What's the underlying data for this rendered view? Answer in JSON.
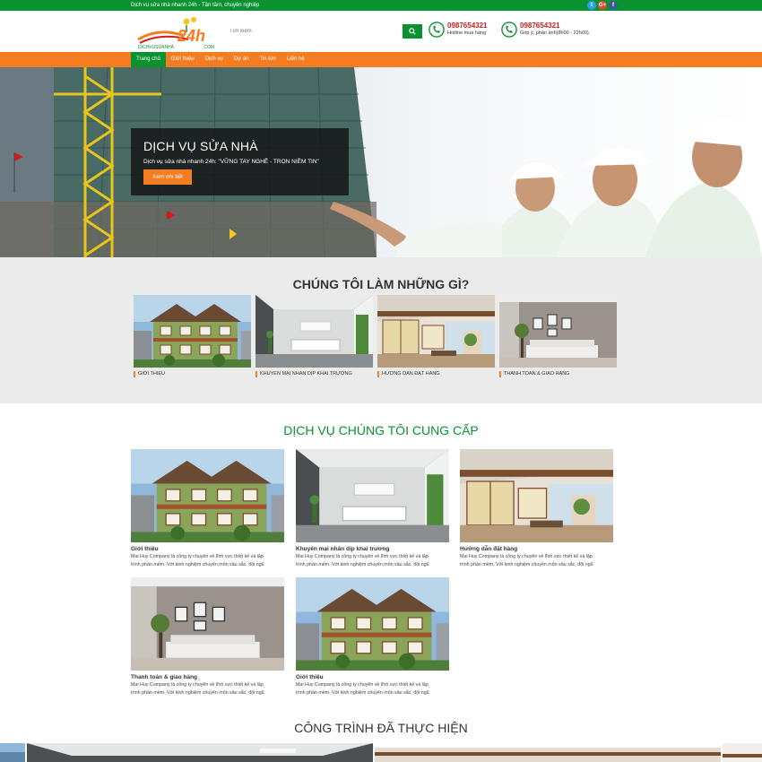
{
  "topbar": {
    "tagline": "Dịch vụ sửa nhà nhanh 24h - Tận tâm, chuyên nghiệp",
    "social": [
      {
        "icon": "twitter-icon",
        "glyph": "t"
      },
      {
        "icon": "google-plus-icon",
        "glyph": "G+"
      },
      {
        "icon": "facebook-icon",
        "glyph": "f"
      }
    ]
  },
  "header": {
    "logo_text": "24h",
    "logo_domain": "DICHVUSUANHA",
    "logo_suffix": ".COM",
    "search_placeholder": "Tìm kiếm",
    "hotlines": [
      {
        "number": "0987654321",
        "label": "Hotline mua hàng"
      },
      {
        "number": "0987654321",
        "label": "Góp ý, phản ánh(8h00 - 22h00)."
      }
    ]
  },
  "nav": {
    "items": [
      "Trang chủ",
      "Giới thiệu",
      "Dịch vụ",
      "Dự án",
      "Tin tức",
      "Liên hệ"
    ],
    "active_index": 0
  },
  "hero": {
    "title": "DỊCH VỤ SỬA NHÀ",
    "subtitle": "Dịch vụ sửa nhà nhanh 24h: \"VỮNG TAY NGHỀ - TRỌN NIỀM TIN\"",
    "button": "Xem chi tiết"
  },
  "what_we_do": {
    "title": "CHÚNG TÔI LÀM NHỮNG GÌ?",
    "cards": [
      {
        "caption": "GIỚI THIỆU"
      },
      {
        "caption": "KHUYẾN MẠI NHÂN DỊP KHAI TRƯƠNG"
      },
      {
        "caption": "HƯỚNG DẪN ĐẶT HÀNG"
      },
      {
        "caption": "THANH TOÁN & GIAO HÀNG"
      }
    ]
  },
  "services": {
    "title": "DỊCH VỤ CHÚNG TÔI CUNG CẤP",
    "items": [
      {
        "title": "Giới thiệu",
        "desc1": "Mai Huy Company là công ty chuyên về lĩnh vực thiết kế và lập",
        "desc2": "trình phần mềm. Với kinh nghiệm chuyên môn sâu sắc, đội ngũ"
      },
      {
        "title": "Khuyến mại nhân dịp khai trương",
        "desc1": "Mai Huy Company là công ty chuyên về lĩnh vực thiết kế và lập",
        "desc2": "trình phần mềm. Với kinh nghiệm chuyên môn sâu sắc, đội ngũ"
      },
      {
        "title": "Hướng dẫn đặt hàng",
        "desc1": "Mai Huy Company là công ty chuyên về lĩnh vực thiết kế và lập",
        "desc2": "trình phần mềm. Với kinh nghiệm chuyên môn sâu sắc, đội ngũ"
      },
      {
        "title": "Thanh toán & giao hàng",
        "desc1": "Mai Huy Company là công ty chuyên về lĩnh vực thiết kế và lập",
        "desc2": "trình phần mềm. Với kinh nghiệm chuyên môn sâu sắc, đội ngũ"
      },
      {
        "title": "Giới thiệu",
        "desc1": "Mai Huy Company là công ty chuyên về lĩnh vực thiết kế và lập",
        "desc2": "trình phần mềm. Với kinh nghiệm chuyên môn sâu sắc, đội ngũ"
      }
    ]
  },
  "projects": {
    "title": "CÔNG TRÌNH ĐÃ THỰC HIỆN"
  },
  "colors": {
    "brand_green": "#0a9130",
    "accent_orange": "#f47d22",
    "hotline_red": "#d21b1b"
  }
}
